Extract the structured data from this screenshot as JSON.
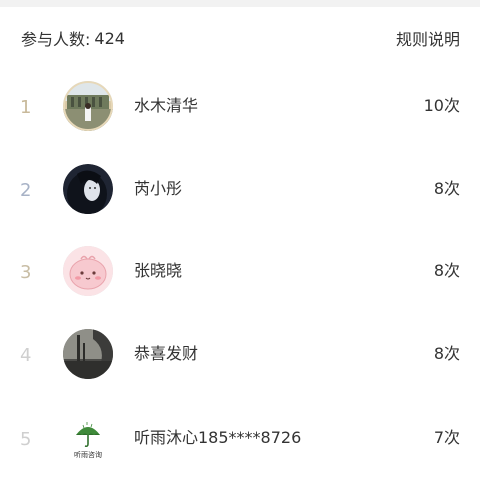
{
  "header": {
    "participants_label": "参与人数:",
    "participants_count": "424",
    "rules_label": "规则说明"
  },
  "ranking": [
    {
      "rank": "1",
      "name": "水木清华",
      "times": "10次",
      "rank_color": "#c8b99a",
      "avatar_icon": "photo-avatar-building"
    },
    {
      "rank": "2",
      "name": "芮小彤",
      "times": "8次",
      "rank_color": "#a7b2c6",
      "avatar_icon": "photo-avatar-girl"
    },
    {
      "rank": "3",
      "name": "张晓晓",
      "times": "8次",
      "rank_color": "#c8bda5",
      "avatar_icon": "cartoon-avatar-pink"
    },
    {
      "rank": "4",
      "name": "恭喜发财",
      "times": "8次",
      "rank_color": "#cfcfcf",
      "avatar_icon": "photo-avatar-dark"
    },
    {
      "rank": "5",
      "name": "听雨沐心185****8726",
      "times": "7次",
      "rank_color": "#cfcfcf",
      "avatar_icon": "logo-avatar-umbrella",
      "avatar_text": "听雨咨询"
    }
  ]
}
